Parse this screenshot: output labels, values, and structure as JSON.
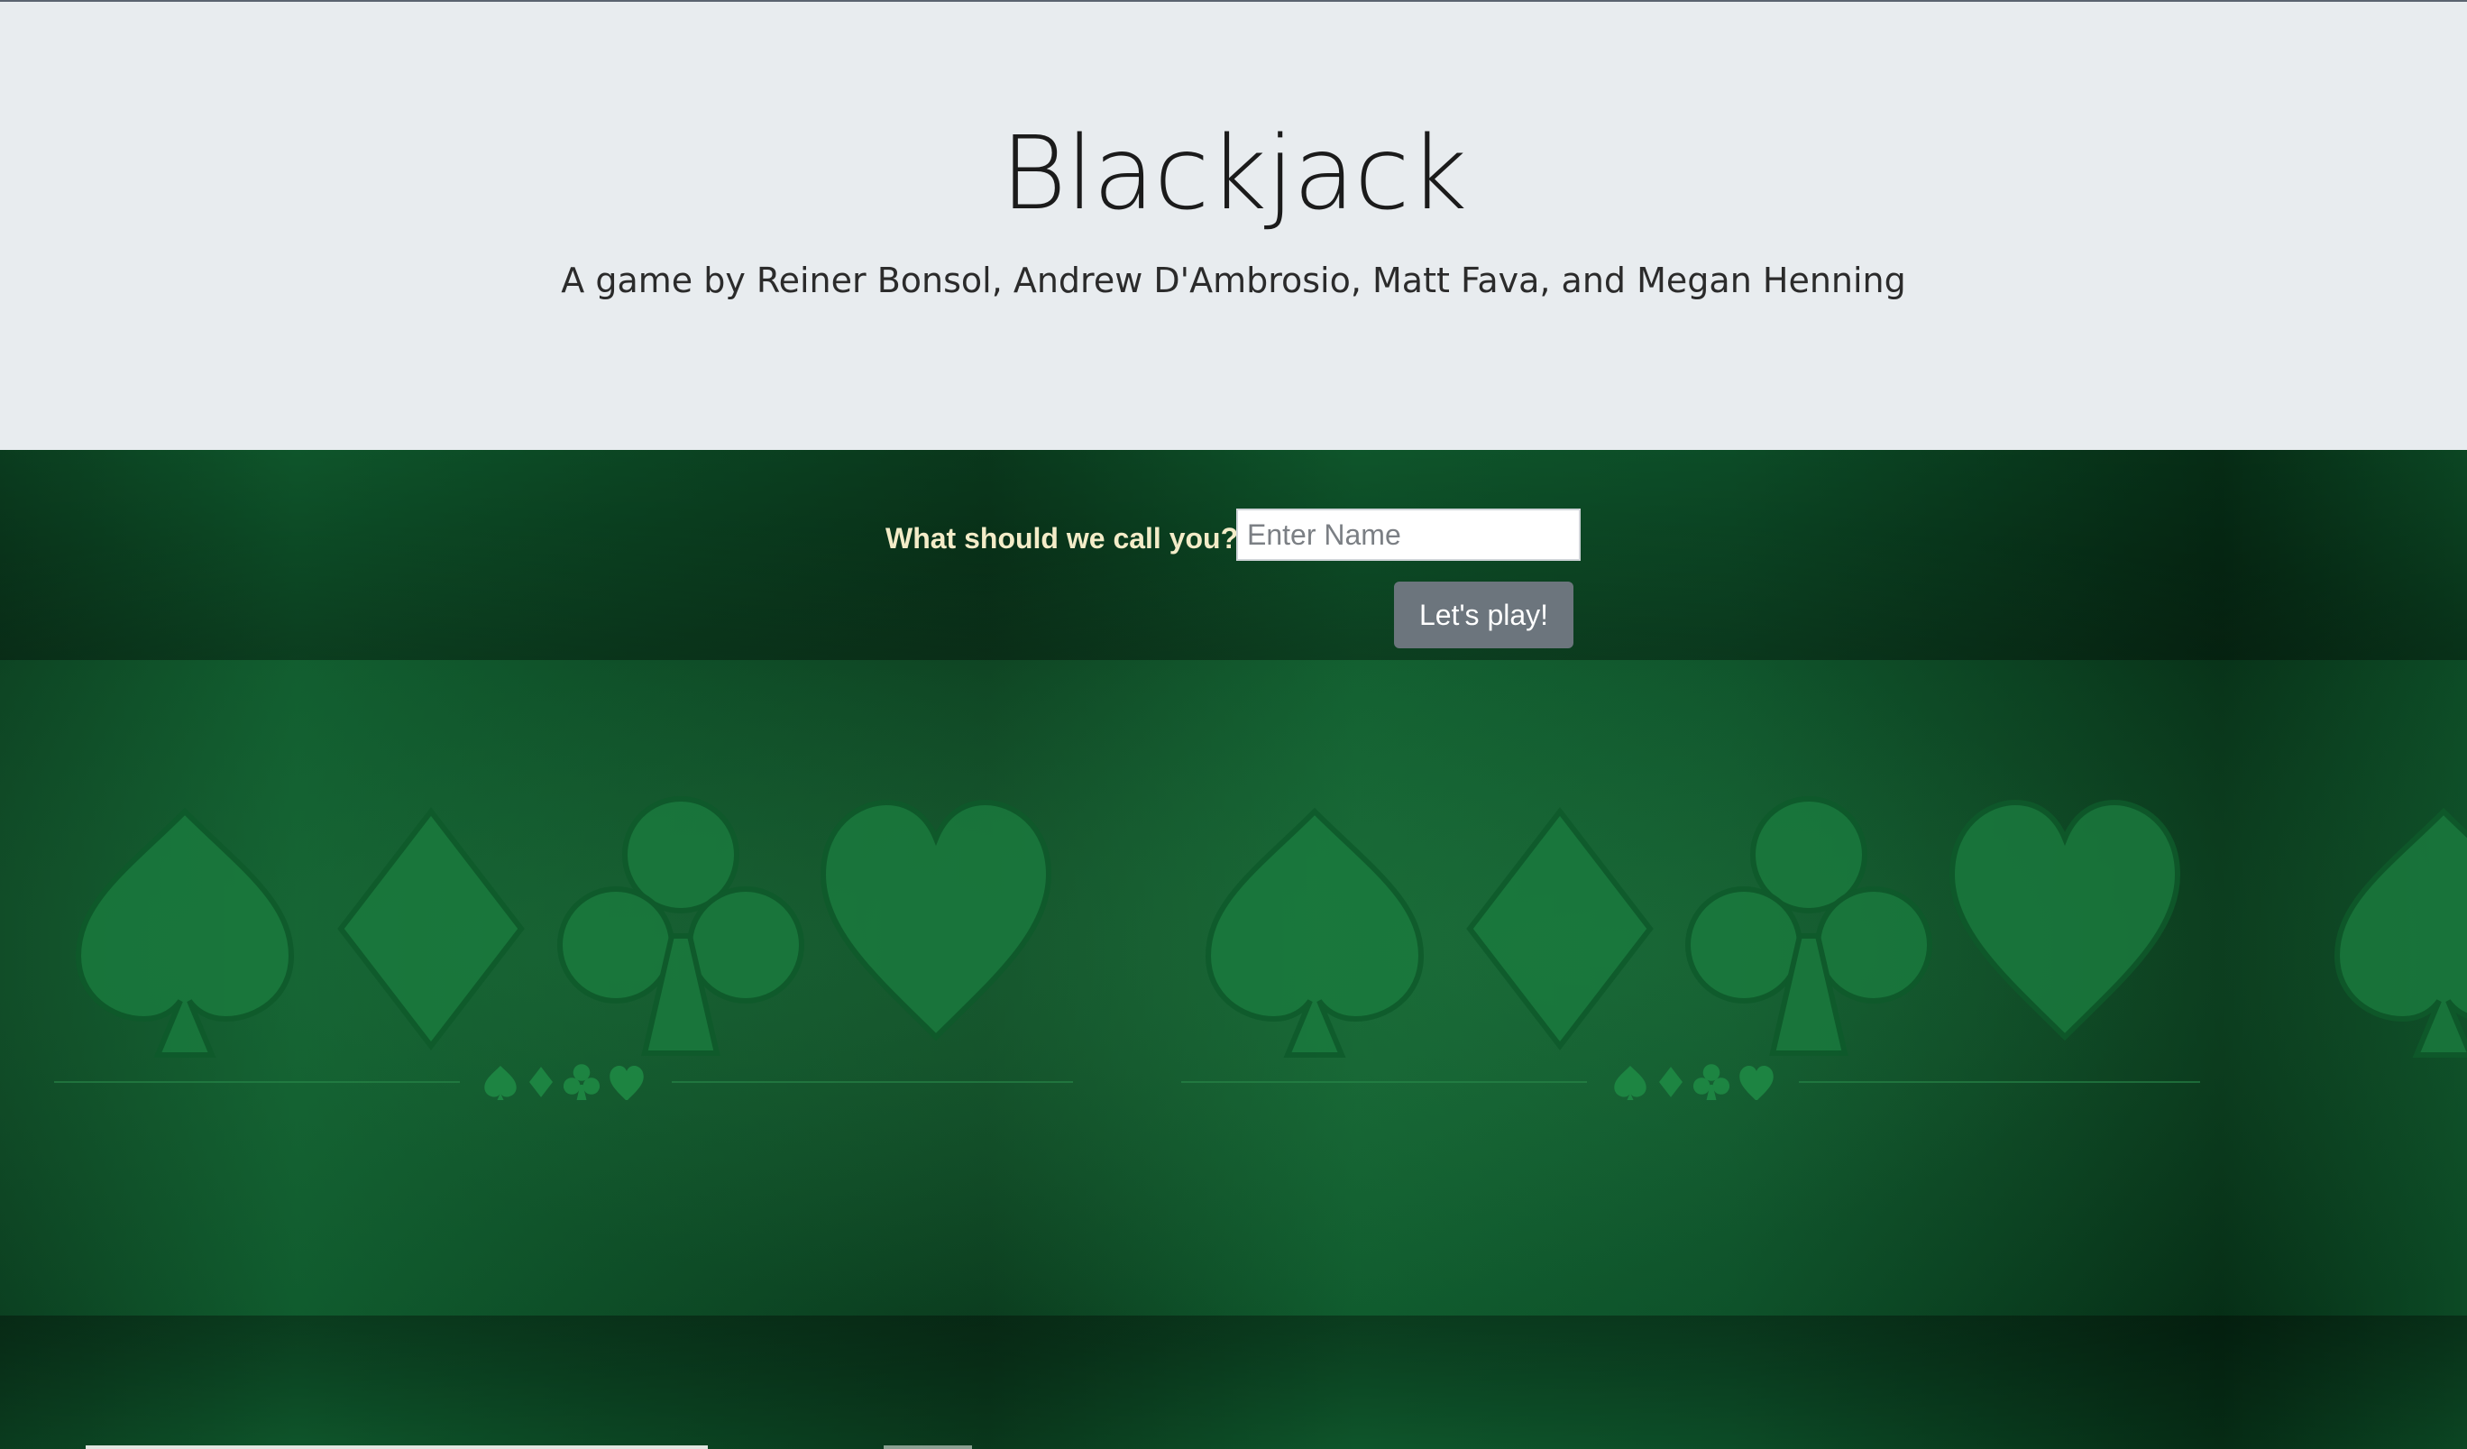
{
  "header": {
    "title": "Blackjack",
    "subtitle": "A game by Reiner Bonsol, Andrew D'Ambrosio, Matt Fava, and Megan Henning"
  },
  "form": {
    "label": "What should we call you?",
    "input_placeholder": "Enter Name",
    "input_value": "",
    "submit_label": "Let's play!"
  },
  "background": {
    "pattern": [
      "spade-icon",
      "diamond-icon",
      "club-icon",
      "heart-icon"
    ],
    "felt_color": "#0d4a26",
    "suit_color": "#1a7a3e"
  },
  "colors": {
    "header_bg": "#e8ecef",
    "label_color": "#f3ecc8",
    "button_bg": "#6c757d"
  }
}
